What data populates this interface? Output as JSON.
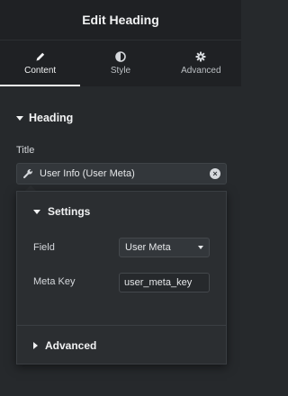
{
  "header": {
    "title": "Edit Heading"
  },
  "tabs": [
    {
      "label": "Content",
      "icon": "pencil-icon",
      "active": true
    },
    {
      "label": "Style",
      "icon": "half-circle-icon",
      "active": false
    },
    {
      "label": "Advanced",
      "icon": "gear-icon",
      "active": false
    }
  ],
  "section": {
    "title": "Heading"
  },
  "title_field": {
    "label": "Title",
    "tag_value": "User Info (User Meta)"
  },
  "popover": {
    "settings_title": "Settings",
    "field_label": "Field",
    "field_value": "User Meta",
    "meta_key_label": "Meta Key",
    "meta_key_value": "user_meta_key",
    "advanced_title": "Advanced"
  },
  "colors": {
    "background": "#26292c",
    "header_bg": "#1f2124",
    "popover_bg": "#2b2e31"
  }
}
